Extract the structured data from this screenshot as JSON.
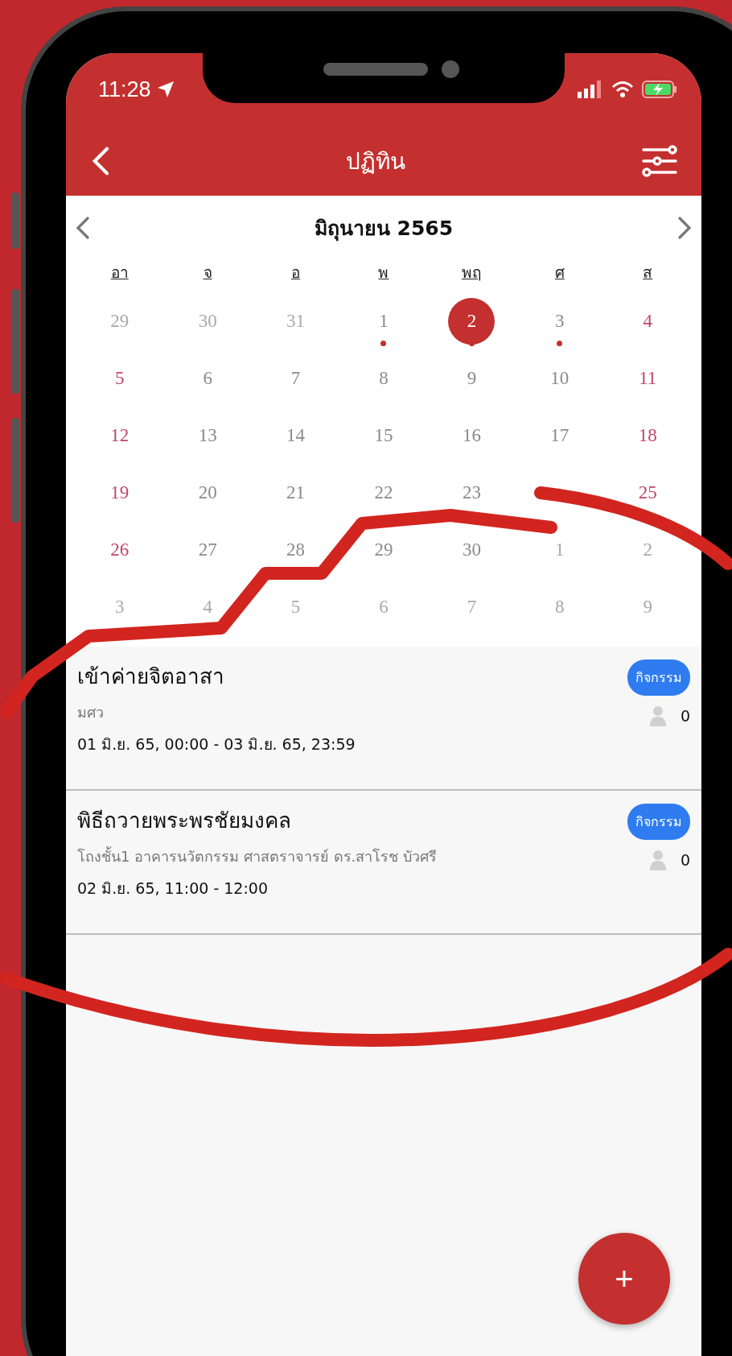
{
  "status_bar": {
    "time": "11:28"
  },
  "nav": {
    "title": "ปฏิทิน"
  },
  "calendar": {
    "month": "มิถุนายน 2565",
    "weekdays": [
      "อา",
      "จ",
      "อ",
      "พ",
      "พฤ",
      "ศ",
      "ส"
    ],
    "weeks": [
      [
        {
          "label": "29",
          "kind": "other",
          "has_event": false,
          "selected": false
        },
        {
          "label": "30",
          "kind": "other",
          "has_event": false,
          "selected": false
        },
        {
          "label": "31",
          "kind": "other",
          "has_event": false,
          "selected": false
        },
        {
          "label": "1",
          "kind": "weekday",
          "has_event": true,
          "selected": false
        },
        {
          "label": "2",
          "kind": "weekday",
          "has_event": true,
          "selected": true
        },
        {
          "label": "3",
          "kind": "weekday",
          "has_event": true,
          "selected": false
        },
        {
          "label": "4",
          "kind": "weekend",
          "has_event": false,
          "selected": false
        }
      ],
      [
        {
          "label": "5",
          "kind": "weekend",
          "has_event": false,
          "selected": false
        },
        {
          "label": "6",
          "kind": "weekday",
          "has_event": false,
          "selected": false
        },
        {
          "label": "7",
          "kind": "weekday",
          "has_event": false,
          "selected": false
        },
        {
          "label": "8",
          "kind": "weekday",
          "has_event": false,
          "selected": false
        },
        {
          "label": "9",
          "kind": "weekday",
          "has_event": false,
          "selected": false
        },
        {
          "label": "10",
          "kind": "weekday",
          "has_event": false,
          "selected": false
        },
        {
          "label": "11",
          "kind": "weekend",
          "has_event": false,
          "selected": false
        }
      ],
      [
        {
          "label": "12",
          "kind": "weekend",
          "has_event": false,
          "selected": false
        },
        {
          "label": "13",
          "kind": "weekday",
          "has_event": false,
          "selected": false
        },
        {
          "label": "14",
          "kind": "weekday",
          "has_event": false,
          "selected": false
        },
        {
          "label": "15",
          "kind": "weekday",
          "has_event": false,
          "selected": false
        },
        {
          "label": "16",
          "kind": "weekday",
          "has_event": false,
          "selected": false
        },
        {
          "label": "17",
          "kind": "weekday",
          "has_event": false,
          "selected": false
        },
        {
          "label": "18",
          "kind": "weekend",
          "has_event": false,
          "selected": false
        }
      ],
      [
        {
          "label": "19",
          "kind": "weekend",
          "has_event": false,
          "selected": false
        },
        {
          "label": "20",
          "kind": "weekday",
          "has_event": false,
          "selected": false
        },
        {
          "label": "21",
          "kind": "weekday",
          "has_event": false,
          "selected": false
        },
        {
          "label": "22",
          "kind": "weekday",
          "has_event": false,
          "selected": false
        },
        {
          "label": "23",
          "kind": "weekday",
          "has_event": false,
          "selected": false
        },
        {
          "kind": "weekday",
          "has_event": false,
          "selected": false
        },
        {
          "label": "25",
          "kind": "weekend",
          "has_event": false,
          "selected": false
        }
      ],
      [
        {
          "label": "26",
          "kind": "weekend",
          "has_event": false,
          "selected": false
        },
        {
          "label": "27",
          "kind": "weekday",
          "has_event": false,
          "selected": false
        },
        {
          "label": "28",
          "kind": "weekday",
          "has_event": false,
          "selected": false
        },
        {
          "label": "29",
          "kind": "weekday",
          "has_event": false,
          "selected": false
        },
        {
          "label": "30",
          "kind": "weekday",
          "has_event": false,
          "selected": false
        },
        {
          "label": "1",
          "kind": "other",
          "has_event": false,
          "selected": false
        },
        {
          "label": "2",
          "kind": "other",
          "has_event": false,
          "selected": false
        }
      ],
      [
        {
          "label": "3",
          "kind": "other",
          "has_event": false,
          "selected": false
        },
        {
          "label": "4",
          "kind": "other",
          "has_event": false,
          "selected": false
        },
        {
          "label": "5",
          "kind": "other",
          "has_event": false,
          "selected": false
        },
        {
          "label": "6",
          "kind": "other",
          "has_event": false,
          "selected": false
        },
        {
          "label": "7",
          "kind": "other",
          "has_event": false,
          "selected": false
        },
        {
          "label": "8",
          "kind": "other",
          "has_event": false,
          "selected": false
        },
        {
          "label": "9",
          "kind": "other",
          "has_event": false,
          "selected": false
        }
      ]
    ]
  },
  "events": [
    {
      "title": "เข้าค่ายจิตอาสา",
      "location": "มศว",
      "time": "01 มิ.ย. 65, 00:00 - 03 มิ.ย. 65, 23:59",
      "tag": "กิจกรรม",
      "count": "0"
    },
    {
      "title": "พิธีถวายพระพรชัยมงคล",
      "location": "โถงชั้น1 อาคารนวัตกรรม ศาสตราจารย์ ดร.สาโรช บัวศรี",
      "time": "02 มิ.ย. 65, 11:00 - 12:00",
      "tag": "กิจกรรม",
      "count": "0"
    }
  ],
  "fab": {
    "label": "+"
  }
}
